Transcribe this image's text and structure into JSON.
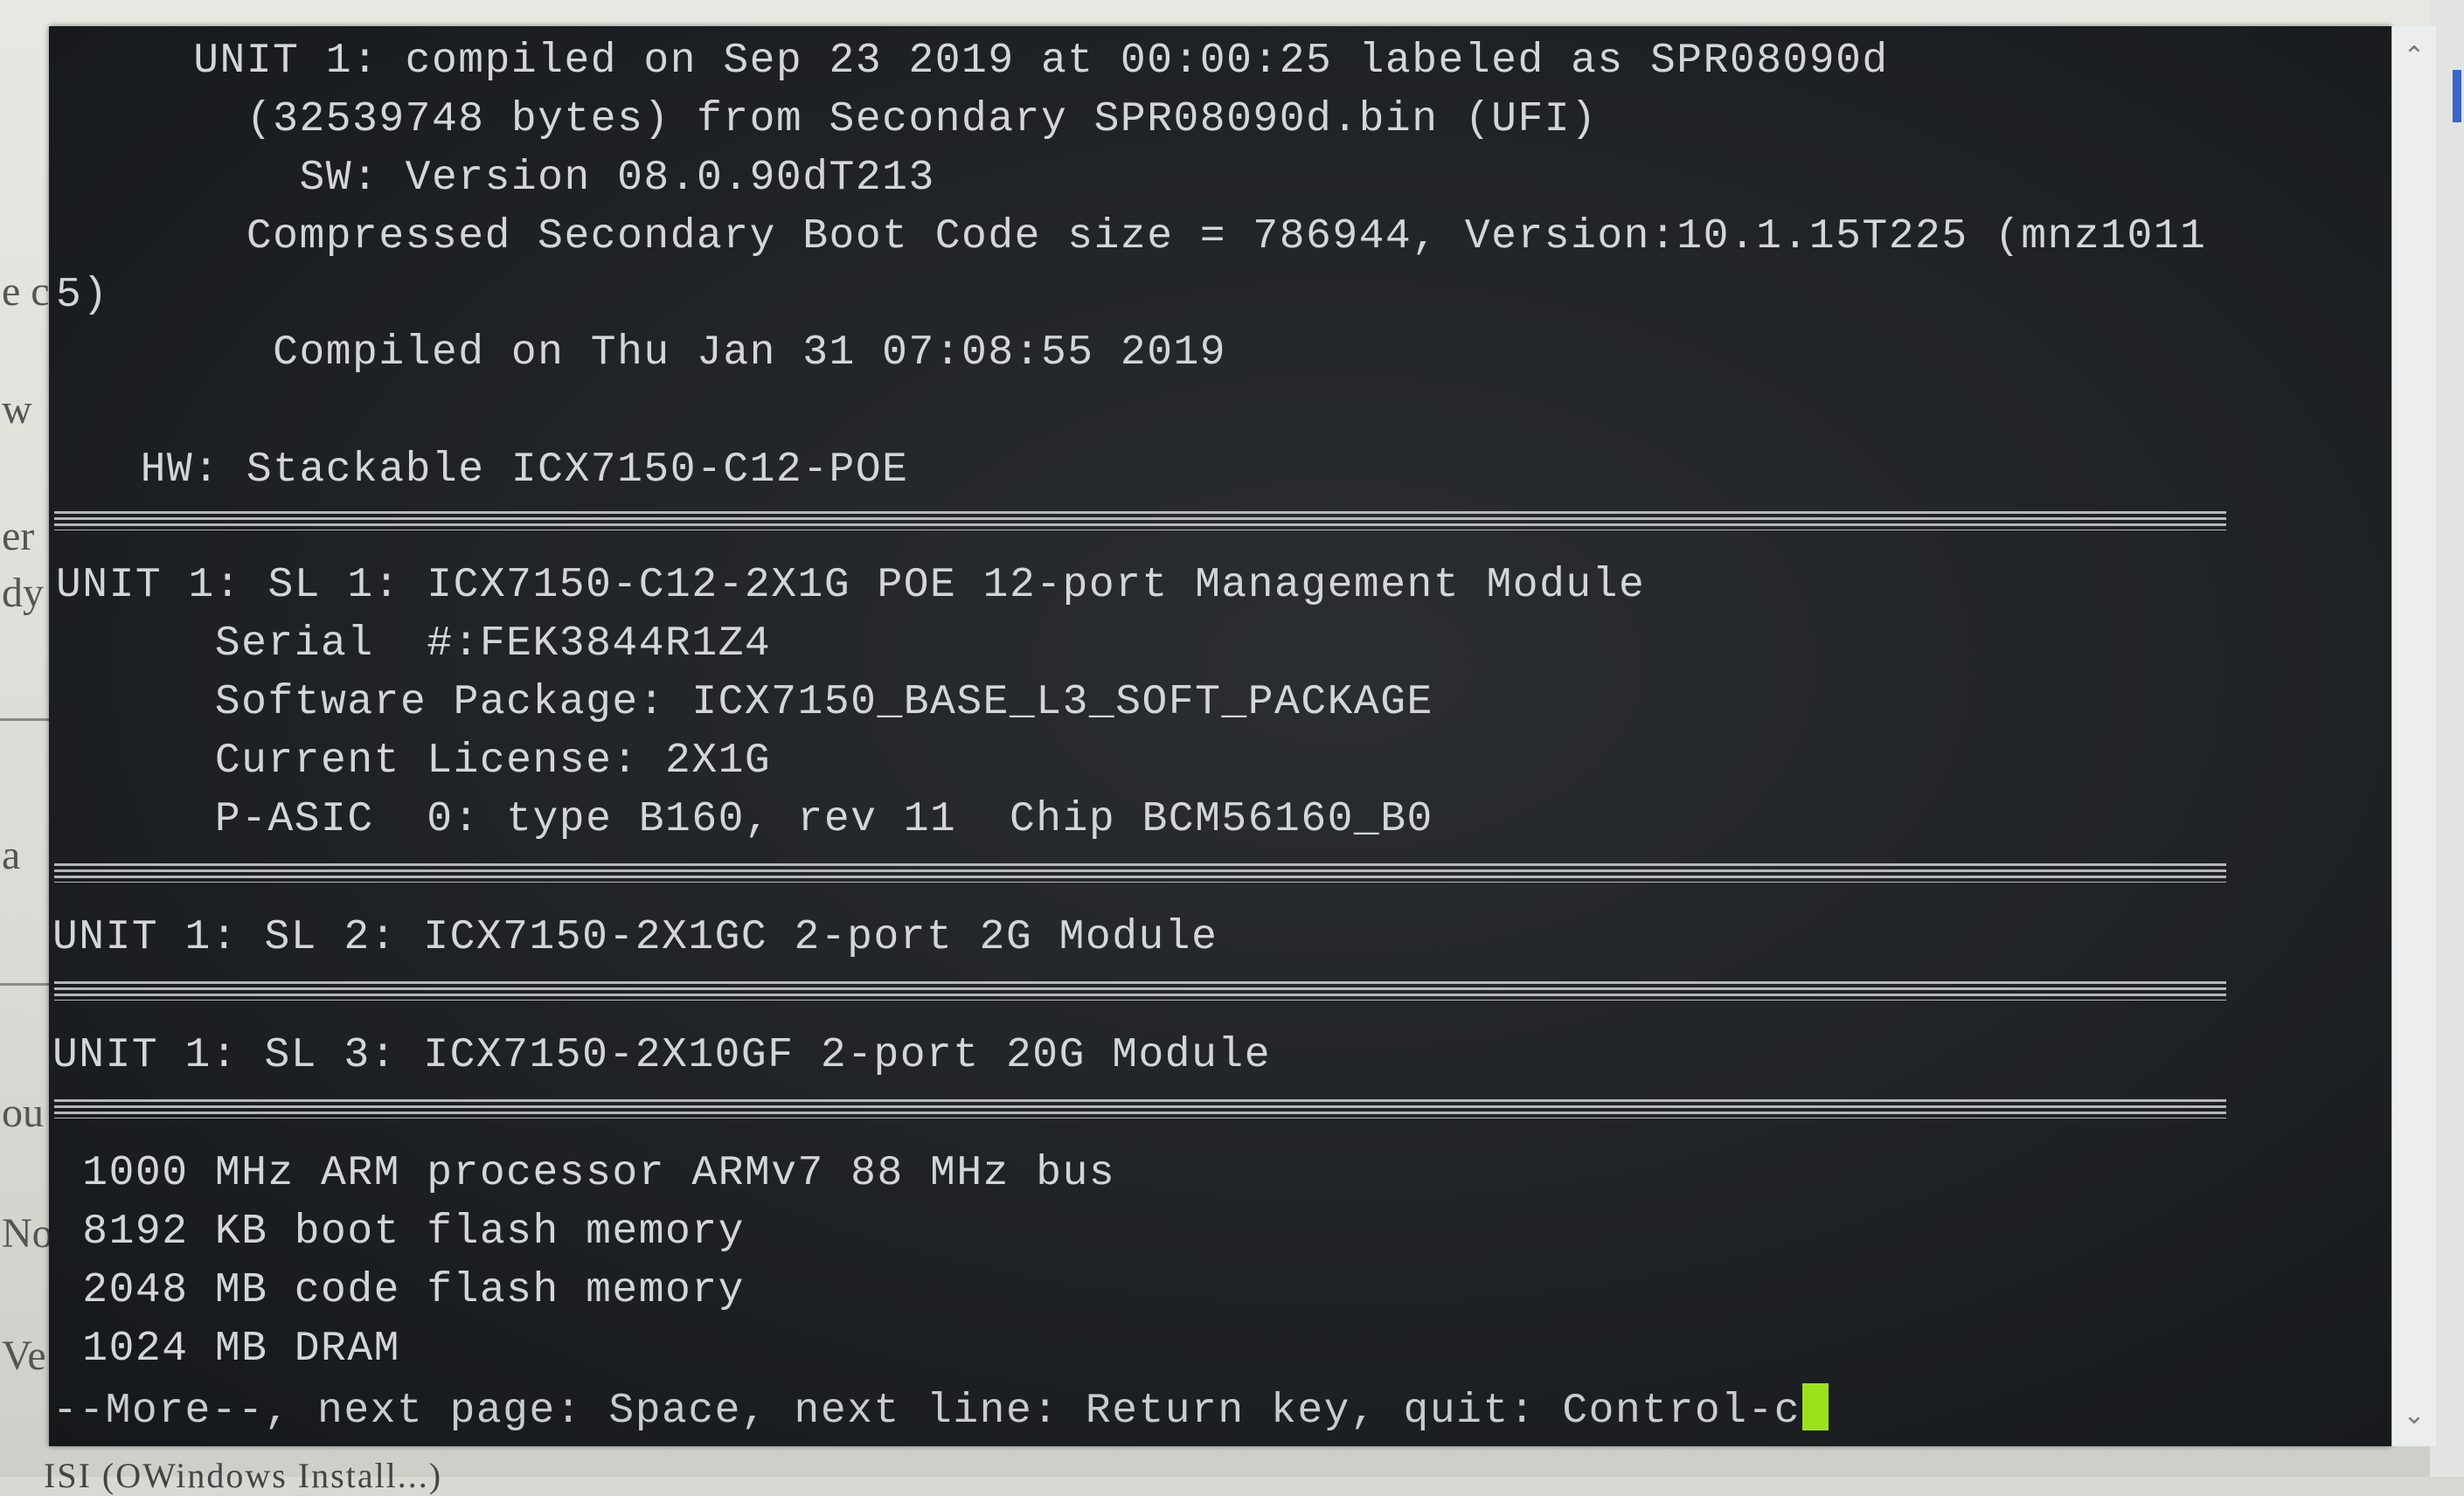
{
  "background": {
    "fragments": [
      "e c",
      "w",
      "er",
      "dy",
      "a",
      "ou",
      "No",
      "Ve"
    ],
    "bottom_text": "ISI (OWindows Install...)"
  },
  "terminal": {
    "lines": [
      "    UNIT 1: compiled on Sep 23 2019 at 00:00:25 labeled as SPR08090d",
      "      (32539748 bytes) from Secondary SPR08090d.bin (UFI)",
      "        SW: Version 08.0.90dT213",
      "      Compressed Secondary Boot Code size = 786944, Version:10.1.15T225 (mnz1011",
      "5)",
      "       Compiled on Thu Jan 31 07:08:55 2019",
      "  HW: Stackable ICX7150-C12-POE",
      "UNIT 1: SL 1: ICX7150-C12-2X1G POE 12-port Management Module",
      "      Serial  #:FEK3844R1Z4",
      "      Software Package: ICX7150_BASE_L3_SOFT_PACKAGE",
      "      Current License: 2X1G",
      "      P-ASIC  0: type B160, rev 11  Chip BCM56160_B0",
      "UNIT 1: SL 2: ICX7150-2X1GC 2-port 2G Module",
      "UNIT 1: SL 3: ICX7150-2X10GF 2-port 20G Module",
      " 1000 MHz ARM processor ARMv7 88 MHz bus",
      " 8192 KB boot flash memory",
      " 2048 MB code flash memory",
      " 1024 MB DRAM"
    ],
    "more_prompt": "--More--, next page: Space, next line: Return key, quit: Control-c",
    "cursor_color": "#9be21b",
    "text_color": "#d2d6d8",
    "background_color": "#1f2225"
  },
  "scrollbar": {
    "up_icon": "chevron-up-icon",
    "down_icon": "chevron-down-icon"
  }
}
